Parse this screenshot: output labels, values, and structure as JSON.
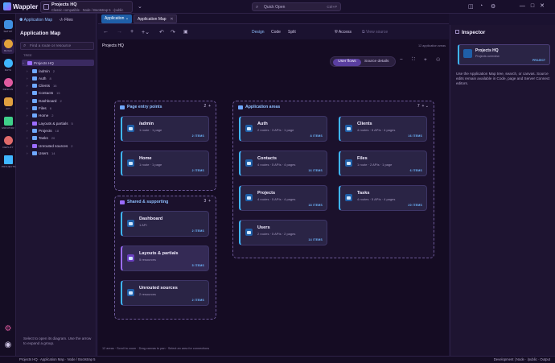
{
  "app": {
    "name": "Wappler"
  },
  "project": {
    "name": "Projects HQ",
    "meta": "Classic compatible · Node / Bootstrap 5 · /public"
  },
  "quick_open": {
    "placeholder": "Quick Open",
    "shortcut": "Ctrl+P"
  },
  "rail": [
    {
      "label": "SETUP",
      "icon": "setup-icon",
      "color": "#3f8fe0"
    },
    {
      "label": "BUILD",
      "icon": "build-icon",
      "color": "#e3a33b",
      "active": true
    },
    {
      "label": "DATA",
      "icon": "data-icon",
      "color": "#3fb6ff"
    },
    {
      "label": "DESIGN",
      "icon": "design-icon",
      "color": "#e05aa0"
    },
    {
      "label": "API",
      "icon": "api-icon",
      "color": "#e0a040"
    },
    {
      "label": "MONITOR",
      "icon": "monitor-icon",
      "color": "#3fd08a"
    },
    {
      "label": "DEPLOY",
      "icon": "deploy-icon",
      "color": "#e06a6a"
    },
    {
      "label": "PROJECTS",
      "icon": "projects-icon",
      "color": "#3fb6ff"
    }
  ],
  "sidebar": {
    "tabs": [
      "Application Map",
      "Files"
    ],
    "title": "Application Map",
    "search_placeholder": "Find a route or resource",
    "tree_label": "TREE",
    "tree": [
      {
        "label": "Projects HQ",
        "count": "",
        "selected": true
      },
      {
        "label": "/admin",
        "count": "2"
      },
      {
        "label": "Auth",
        "count": "8"
      },
      {
        "label": "Clients",
        "count": "16"
      },
      {
        "label": "Contacts",
        "count": "15"
      },
      {
        "label": "Dashboard",
        "count": "2"
      },
      {
        "label": "Files",
        "count": "6"
      },
      {
        "label": "Home",
        "count": "2"
      },
      {
        "label": "Layouts & partials",
        "count": "5"
      },
      {
        "label": "Projects",
        "count": "18"
      },
      {
        "label": "Tasks",
        "count": "20"
      },
      {
        "label": "Unrouted sources",
        "count": "2"
      },
      {
        "label": "Users",
        "count": "14"
      }
    ],
    "hint": "Select to open its diagram. Use the arrow to expand a group."
  },
  "editor": {
    "tabs": [
      "Application",
      "Application Map"
    ],
    "modes": [
      "Design",
      "Code",
      "Split"
    ],
    "access": "Access",
    "view_source": "View source",
    "canvas_title": "Projects HQ",
    "canvas_count": "12 application areas",
    "segment": [
      "User flows",
      "Source details"
    ],
    "footer": "12 areas · Scroll to zoom · Drag canvas to pan · Select an area for connections"
  },
  "groups": {
    "entry": {
      "title": "Page entry points",
      "count": "2"
    },
    "areas": {
      "title": "Application areas",
      "count": "7"
    },
    "shared": {
      "title": "Shared & supporting",
      "count": "3"
    }
  },
  "cards": {
    "admin": {
      "name": "/admin",
      "meta": "1 route · 1 page",
      "items": "2 ITEMS"
    },
    "home": {
      "name": "Home",
      "meta": "1 route · 1 page",
      "items": "2 ITEMS"
    },
    "auth": {
      "name": "Auth",
      "meta": "2 routes · 3 APIs · 1 page",
      "items": "8 ITEMS"
    },
    "clients": {
      "name": "Clients",
      "meta": "4 routes · 5 APIs · 4 pages",
      "items": "16 ITEMS"
    },
    "contacts": {
      "name": "Contacts",
      "meta": "4 routes · 5 APIs · 4 pages",
      "items": "16 ITEMS"
    },
    "files": {
      "name": "Files",
      "meta": "1 route · 2 APIs · 1 page",
      "items": "6 ITEMS"
    },
    "projects": {
      "name": "Projects",
      "meta": "4 routes · 5 APIs · 4 pages",
      "items": "18 ITEMS"
    },
    "tasks": {
      "name": "Tasks",
      "meta": "4 routes · 5 APIs · 4 pages",
      "items": "20 ITEMS"
    },
    "users": {
      "name": "Users",
      "meta": "2 routes · 5 APIs · 2 pages",
      "items": "14 ITEMS"
    },
    "dashboard": {
      "name": "Dashboard",
      "meta": "1 API",
      "items": "2 ITEMS"
    },
    "layouts": {
      "name": "Layouts & partials",
      "meta": "5 resources",
      "items": "5 ITEMS"
    },
    "unrouted": {
      "name": "Unrouted sources",
      "meta": "2 resources",
      "items": "2 ITEMS"
    }
  },
  "inspector": {
    "title": "Inspector",
    "card_name": "Projects HQ",
    "card_sub": "Projects overview",
    "card_badge": "PROJECT",
    "description": "Use the Application Map tree, search, or canvas. Source edits remain available in Code, page and Server Connect editors."
  },
  "status": {
    "left": "Projects HQ · Application Map · Node / Bootstrap 5",
    "right": "Development | Node · /public · Output"
  }
}
